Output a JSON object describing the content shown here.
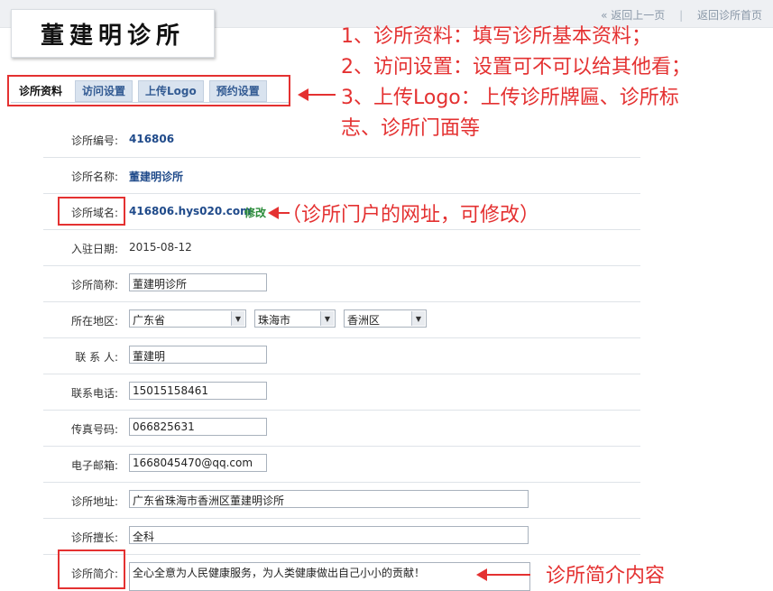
{
  "topnav": {
    "back": "« 返回上一页",
    "home": "返回诊所首页"
  },
  "logo": {
    "text": "董建明诊所"
  },
  "tabs": [
    {
      "label": "诊所资料",
      "active": true
    },
    {
      "label": "访问设置",
      "active": false
    },
    {
      "label": "上传Logo",
      "active": false
    },
    {
      "label": "预约设置",
      "active": false
    }
  ],
  "annotations": {
    "list": [
      "1、诊所资料：填写诊所基本资料；",
      "2、访问设置：设置可不可以给其他看；",
      "3、上传Logo：上传诊所牌匾、诊所标",
      "志、诊所门面等"
    ],
    "domain_note": "（诊所门户的网址，可修改）",
    "intro_note": "诊所简介内容"
  },
  "form": {
    "clinic_id": {
      "label": "诊所编号:",
      "value": "416806"
    },
    "clinic_name": {
      "label": "诊所名称:",
      "value": "董建明诊所"
    },
    "domain": {
      "label": "诊所域名:",
      "value": "416806.hys020.com",
      "edit": "修改"
    },
    "join_date": {
      "label": "入驻日期:",
      "value": "2015-08-12"
    },
    "short_name": {
      "label": "诊所简称:",
      "value": "董建明诊所"
    },
    "region": {
      "label": "所在地区:",
      "province": "广东省",
      "city": "珠海市",
      "district": "香洲区"
    },
    "contact": {
      "label": "联 系 人:",
      "value": "董建明"
    },
    "phone": {
      "label": "联系电话:",
      "value": "15015158461"
    },
    "fax": {
      "label": "传真号码:",
      "value": "066825631"
    },
    "email": {
      "label": "电子邮箱:",
      "value": "1668045470@qq.com"
    },
    "address": {
      "label": "诊所地址:",
      "value": "广东省珠海市香洲区董建明诊所"
    },
    "specialty": {
      "label": "诊所擅长:",
      "value": "全科"
    },
    "intro": {
      "label": "诊所简介:",
      "value": "全心全意为人民健康服务，为人类健康做出自己小小的贡献！"
    }
  },
  "colors": {
    "accent_red": "#e43131",
    "link_blue": "#1f4a8a",
    "edit_green": "#2b8b3a",
    "tab_bg": "#d9e3ef"
  }
}
